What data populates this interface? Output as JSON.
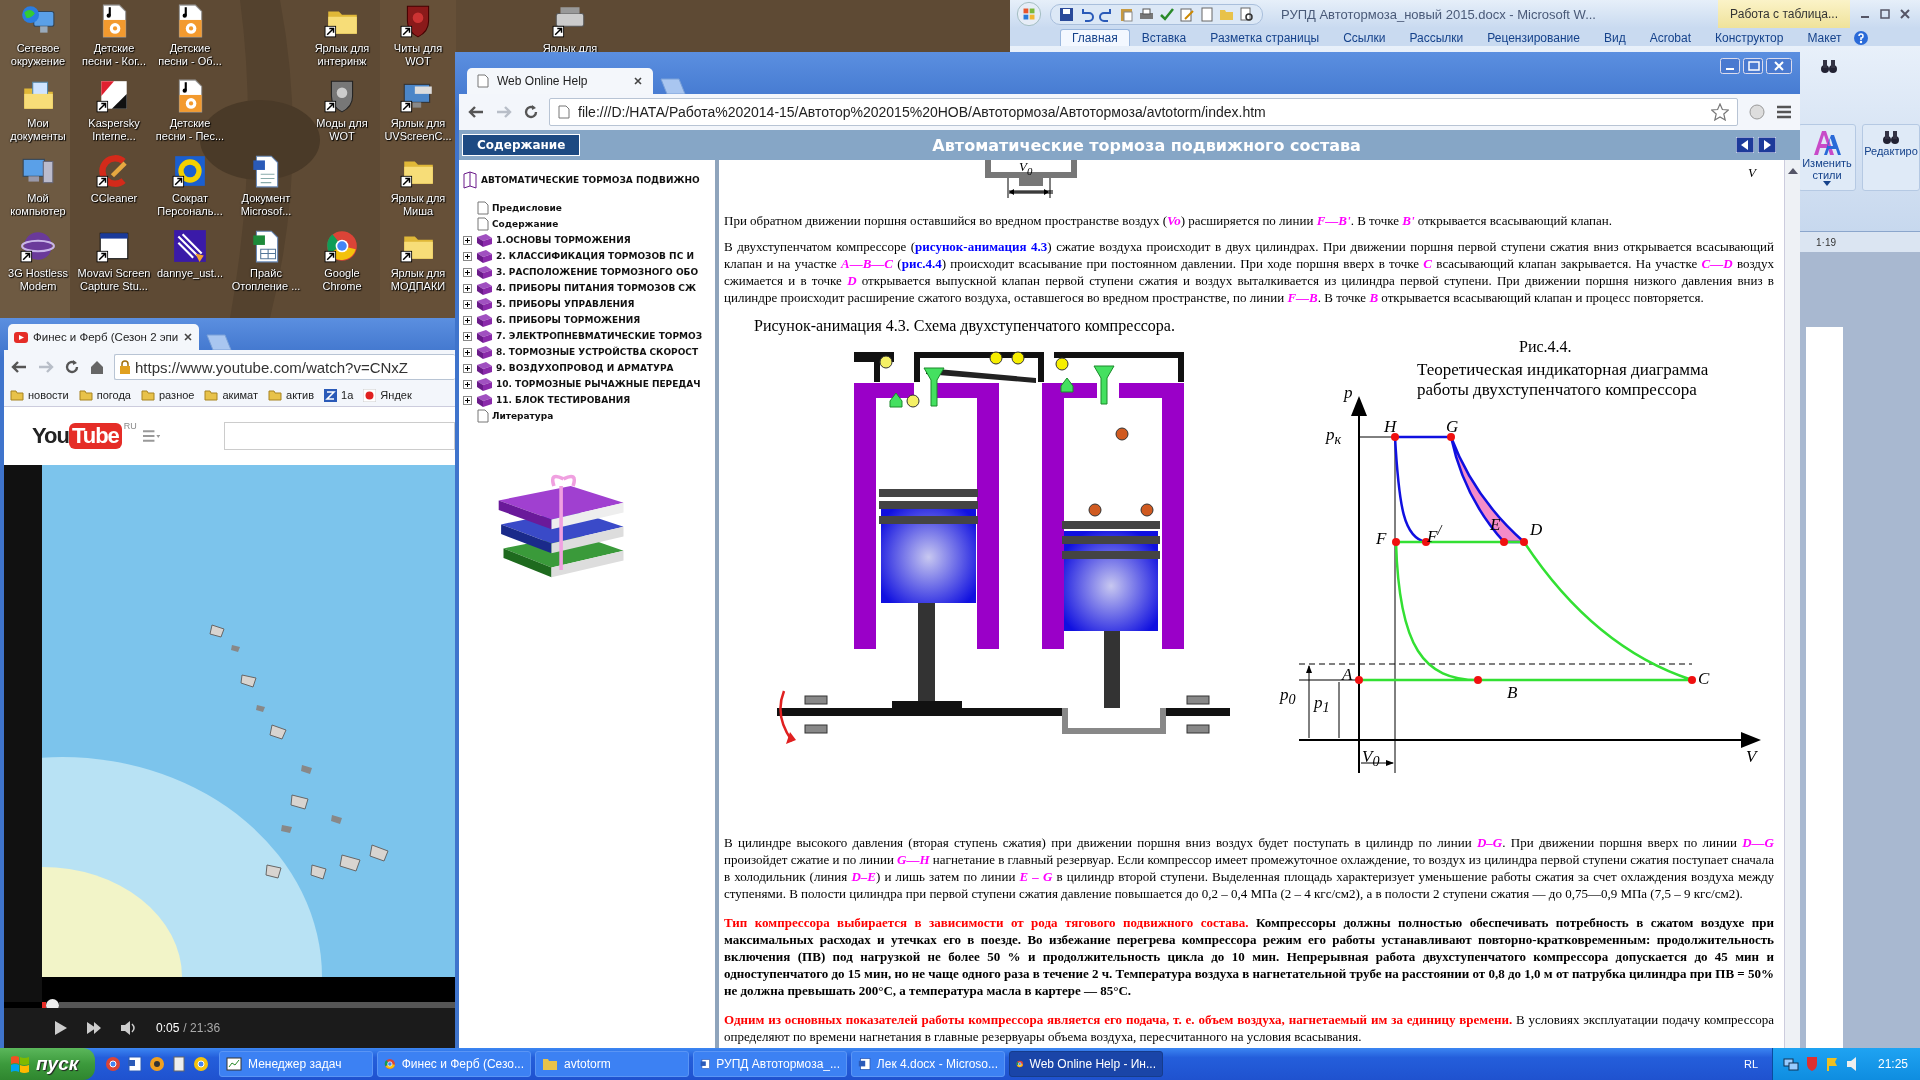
{
  "desktop": {
    "icons": [
      {
        "label": "Сетевое\nокружение",
        "kind": "network",
        "shortcut": false
      },
      {
        "label": "Детские\nпесни - Ког...",
        "kind": "music",
        "shortcut": false
      },
      {
        "label": "Детские\nпесни - Об...",
        "kind": "music",
        "shortcut": false
      },
      {
        "label": "Ярлык для\nинтеринж",
        "kind": "folder",
        "shortcut": true
      },
      {
        "label": "Читы для\nWOT",
        "kind": "shield",
        "shortcut": true
      },
      {
        "label": "Ярлык для",
        "kind": "drive",
        "shortcut": true
      },
      {
        "label": "Мои\nдокументы",
        "kind": "docfolder",
        "shortcut": false
      },
      {
        "label": "Kaspersky\nInterne...",
        "kind": "emblem",
        "shortcut": true
      },
      {
        "label": "Детские\nпесни - Пес...",
        "kind": "music",
        "shortcut": false
      },
      {
        "label": "Моды для\nWOT",
        "kind": "greyshield",
        "shortcut": true
      },
      {
        "label": "Ярлык для\nUVScreenC...",
        "kind": "monitor",
        "shortcut": true
      },
      {
        "label": "Мой\nкомпьютер",
        "kind": "computer",
        "shortcut": false
      },
      {
        "label": "CCleaner",
        "kind": "brush",
        "shortcut": true
      },
      {
        "label": "Сократ\nПерсональ...",
        "kind": "round",
        "shortcut": true
      },
      {
        "label": "Документ\nMicrosof...",
        "kind": "document",
        "shortcut": false
      },
      {
        "label": "Ярлык для\nМиша",
        "kind": "folder",
        "shortcut": true
      },
      {
        "label": "3G Hostless\nModem",
        "kind": "sphere",
        "shortcut": true
      },
      {
        "label": "Movavi Screen\nCapture Stu...",
        "kind": "window",
        "shortcut": true
      },
      {
        "label": "dannye_ust...",
        "kind": "clip",
        "shortcut": false
      },
      {
        "label": "Прайс\nОтопление ...",
        "kind": "sheet",
        "shortcut": false
      },
      {
        "label": "Google\nChrome",
        "kind": "browser",
        "shortcut": true
      },
      {
        "label": "Ярлык для\nМОДПАКИ",
        "kind": "folder",
        "shortcut": true
      }
    ]
  },
  "word": {
    "title": "РУПД Автотормоза_новый 2015.docx - Microsoft W...",
    "context_tab": "Работа с таблица...",
    "tabs": [
      {
        "label": "Главная",
        "selected": true
      },
      {
        "label": "Вставка",
        "selected": false
      },
      {
        "label": "Разметка страницы",
        "selected": false
      },
      {
        "label": "Ссылки",
        "selected": false
      },
      {
        "label": "Рассылки",
        "selected": false
      },
      {
        "label": "Рецензирование",
        "selected": false
      },
      {
        "label": "Вид",
        "selected": false
      },
      {
        "label": "Acrobat",
        "selected": false
      },
      {
        "label": "Конструктор",
        "selected": false
      },
      {
        "label": "Макет",
        "selected": false
      }
    ],
    "styles_button": "Изменить\nстили",
    "editing_button": "Редактиро",
    "ruler_mark": "1·19"
  },
  "help_browser": {
    "tab_title": "Web Online Help",
    "address": "file:///D:/НАТА/Работа%202014-15/Автотор%202015%20НОВ/Автотормоза/Автотормоза/avtotorm/index.htm",
    "contents_button": "Содержание",
    "title": "Автоматические тормоза подвижного состава",
    "toc": {
      "root": "АВТОМАТИЧЕСКИЕ ТОРМОЗА ПОДВИЖНО",
      "items": [
        {
          "kind": "page",
          "label": "Предисловие"
        },
        {
          "kind": "page",
          "label": "Содержание"
        },
        {
          "kind": "book",
          "label": "1.ОСНОВЫ ТОРМОЖЕНИЯ",
          "expanded": false
        },
        {
          "kind": "book",
          "label": "2. КЛАССИФИКАЦИЯ ТОРМОЗОВ ПС И",
          "expanded": false
        },
        {
          "kind": "book",
          "label": "3. РАСПОЛОЖЕНИЕ ТОРМОЗНОГО ОБО",
          "expanded": false
        },
        {
          "kind": "book",
          "label": "4. ПРИБОРЫ ПИТАНИЯ ТОРМОЗОВ СЖ",
          "expanded": false
        },
        {
          "kind": "book",
          "label": "5. ПРИБОРЫ УПРАВЛЕНИЯ",
          "expanded": false
        },
        {
          "kind": "book",
          "label": "6. ПРИБОРЫ ТОРМОЖЕНИЯ",
          "expanded": false
        },
        {
          "kind": "book",
          "label": "7. ЭЛЕКТРОПНЕВМАТИЧЕСКИЕ ТОРМОЗ",
          "expanded": false
        },
        {
          "kind": "book",
          "label": "8. ТОРМОЗНЫЕ УСТРОЙСТВА СКОРОСТ",
          "expanded": false
        },
        {
          "kind": "book",
          "label": "9. ВОЗДУХОПРОВОД И АРМАТУРА",
          "expanded": false
        },
        {
          "kind": "book",
          "label": "10. ТОРМОЗНЫЕ РЫЧАЖНЫЕ ПЕРЕДАЧ",
          "expanded": false
        },
        {
          "kind": "book",
          "label": "11. БЛОК ТЕСТИРОВАНИЯ",
          "expanded": false
        },
        {
          "kind": "page",
          "label": "Литература"
        }
      ]
    },
    "content": {
      "top_labels": [
        "V$_{0}$",
        "V"
      ],
      "paragraphs_top": [
        [
          {
            "kind": "text",
            "text": "При обратном движении поршня оставшийся во вредном пространстве воздух ("
          },
          {
            "kind": "var",
            "text": "Vo"
          },
          {
            "kind": "text",
            "text": ") расширяется по линии "
          },
          {
            "kind": "var",
            "text": "F—B'"
          },
          {
            "kind": "text",
            "text": ". В точке "
          },
          {
            "kind": "var",
            "text": "B'"
          },
          {
            "kind": "text",
            "text": " открывается всасывающий клапан."
          }
        ],
        [
          {
            "kind": "text",
            "text": "В двухступенчатом компрессоре ("
          },
          {
            "kind": "link",
            "text": "рисунок-анимация 4.3"
          },
          {
            "kind": "text",
            "text": ") сжатие воздуха происходит в двух цилиндрах. При движении поршня первой ступени сжатия вниз открывается всасывающий клапан и на участке "
          },
          {
            "kind": "var",
            "text": "A—B—C"
          },
          {
            "kind": "text",
            "text": " ("
          },
          {
            "kind": "link",
            "text": "рис.4.4"
          },
          {
            "kind": "text",
            "text": ") происходит всасывание при постоянном давлении. При ходе поршня вверх в точке "
          },
          {
            "kind": "var",
            "text": "C"
          },
          {
            "kind": "text",
            "text": " всасывающий клапан закрывается. На участке "
          },
          {
            "kind": "var",
            "text": "C—D"
          },
          {
            "kind": "text",
            "text": " воздух сжимается и в точке "
          },
          {
            "kind": "var",
            "text": "D"
          },
          {
            "kind": "text",
            "text": " открывается выпускной клапан первой ступени сжатия и воздух выталкивается из цилиндра первой ступени. При движении поршня низкого давления вниз в цилиндре происходит расширение сжатого воздуха, оставшегося во вредном пространстве, по линии "
          },
          {
            "kind": "var",
            "text": "F—B"
          },
          {
            "kind": "text",
            "text": ". В точке "
          },
          {
            "kind": "var",
            "text": "B"
          },
          {
            "kind": "text",
            "text": " открывается всасывающий клапан и процесс повторяется."
          }
        ]
      ],
      "figure_43": {
        "caption": "Рисунок-анимация 4.3. Схема двухступенчатого компрессора."
      },
      "figure_44": {
        "number": "Рис.4.4.",
        "title": "Теоретическая индикаторная диаграмма работы двухступенчатого компрессора",
        "labels": [
          "p",
          "p$_{к}$",
          "H",
          "G",
          "F",
          "F$^{/}$",
          "E",
          "D",
          "A",
          "B",
          "C",
          "p$_{0}$",
          "p$_{1}$",
          "V$_{0}$",
          "V"
        ]
      },
      "paragraphs_bottom": [
        [
          {
            "kind": "text",
            "text": "В цилиндре высокого давления (вторая ступень сжатия) при движении поршня вниз воздух будет поступать в цилиндр по линии "
          },
          {
            "kind": "var",
            "text": "D–G"
          },
          {
            "kind": "text",
            "text": ". При движении поршня вверх по линии "
          },
          {
            "kind": "var",
            "text": "D—G"
          },
          {
            "kind": "text",
            "text": " произойдет сжатие и по линии "
          },
          {
            "kind": "var",
            "text": "G—H"
          },
          {
            "kind": "text",
            "text": " нагнетание в главный резервуар. Если компрессор имеет промежуточное охлаждение, то воздух из цилиндра первой ступени сжатия поступает сначала в холодильник (линия "
          },
          {
            "kind": "var",
            "text": "D–E"
          },
          {
            "kind": "text",
            "text": ") и лишь затем по линии "
          },
          {
            "kind": "var",
            "text": "E – G"
          },
          {
            "kind": "text",
            "text": " в цилиндр второй ступени. Выделенная площадь характеризует уменьшение работы сжатия за счет охлаждения воздуха между ступенями. В полости цилиндра при первой ступени сжатия давление повышается до 0,2 – 0,4 МПа (2 – 4 кгс/см2), а в полости 2 ступени сжатия — до 0,75—0,9 МПа (7,5 – 9 кгс/см2)."
          }
        ],
        [
          {
            "kind": "red",
            "text": "Тип компрессора выбирается в зависимости от рода тягового подвижного состава."
          },
          {
            "kind": "strong",
            "text": " Компрессоры должны полностью обеспечивать потребность в сжатом воздухе при максимальных расходах и утечках его в поезде. Во избежание перегрева компрессора режим его работы устанавливают повторно-кратковременным: продолжительность включения (ПВ) под нагрузкой не более 50 % и продолжительность цикла до 10 мин. Непрерывная работа двухступенчатого компрессора допускается до 45 мин и одноступенчатого до 15 мин, но не чаще одного раза в течение 2 ч. Температура воздуха в нагнетательной трубе на расстоянии от 0,8 до 1,0 м от патрубка цилиндра при ПВ = 50% не должна превышать 200°С, а температура масла в картере — 85°С."
          }
        ],
        [
          {
            "kind": "red",
            "text": "Одним из основных показателей работы компрессора является его подача, т. е. объем воздуха, нагнетаемый им за единицу времени."
          },
          {
            "kind": "text",
            "text": " В условиях эксплуатации подачу компрессора определяют по времени нагнетания в главные резервуары объема воздуха, пересчитанного на условия всасывания."
          }
        ]
      ]
    }
  },
  "youtube_browser": {
    "tab_title": "Финес и Ферб (Сезон 2 эпи",
    "address": "https://www.youtube.com/watch?v=CNxZ",
    "bookmarks": [
      {
        "label": "новости",
        "kind": "folder"
      },
      {
        "label": "погода",
        "kind": "folder"
      },
      {
        "label": "разное",
        "kind": "folder"
      },
      {
        "label": "акимат",
        "kind": "folder"
      },
      {
        "label": "актив",
        "kind": "folder"
      },
      {
        "label": "1а",
        "kind": "site"
      },
      {
        "label": "Яндек",
        "kind": "yandex"
      }
    ],
    "logo_left": "You",
    "logo_right": "Tube",
    "region": "RU",
    "progress": {
      "level": 0.01
    },
    "time_current": "0:05",
    "time_total": "/ 21:36"
  },
  "taskbar": {
    "start": "пуск",
    "tasks": [
      {
        "label": "Менеджер задач",
        "kind": "taskmgr",
        "selected": false
      },
      {
        "label": "Финес и Ферб (Сезо...",
        "kind": "browser",
        "selected": false
      },
      {
        "label": "avtotorm",
        "kind": "folder",
        "selected": false
      },
      {
        "label": "РУПД Автотормоза_...",
        "kind": "word",
        "selected": false
      },
      {
        "label": "Лек 4.docx - Microso...",
        "kind": "word",
        "selected": false
      },
      {
        "label": "Web Online Help - Ин...",
        "kind": "browser",
        "selected": true
      }
    ],
    "language": "RL",
    "clock": "21:25"
  }
}
